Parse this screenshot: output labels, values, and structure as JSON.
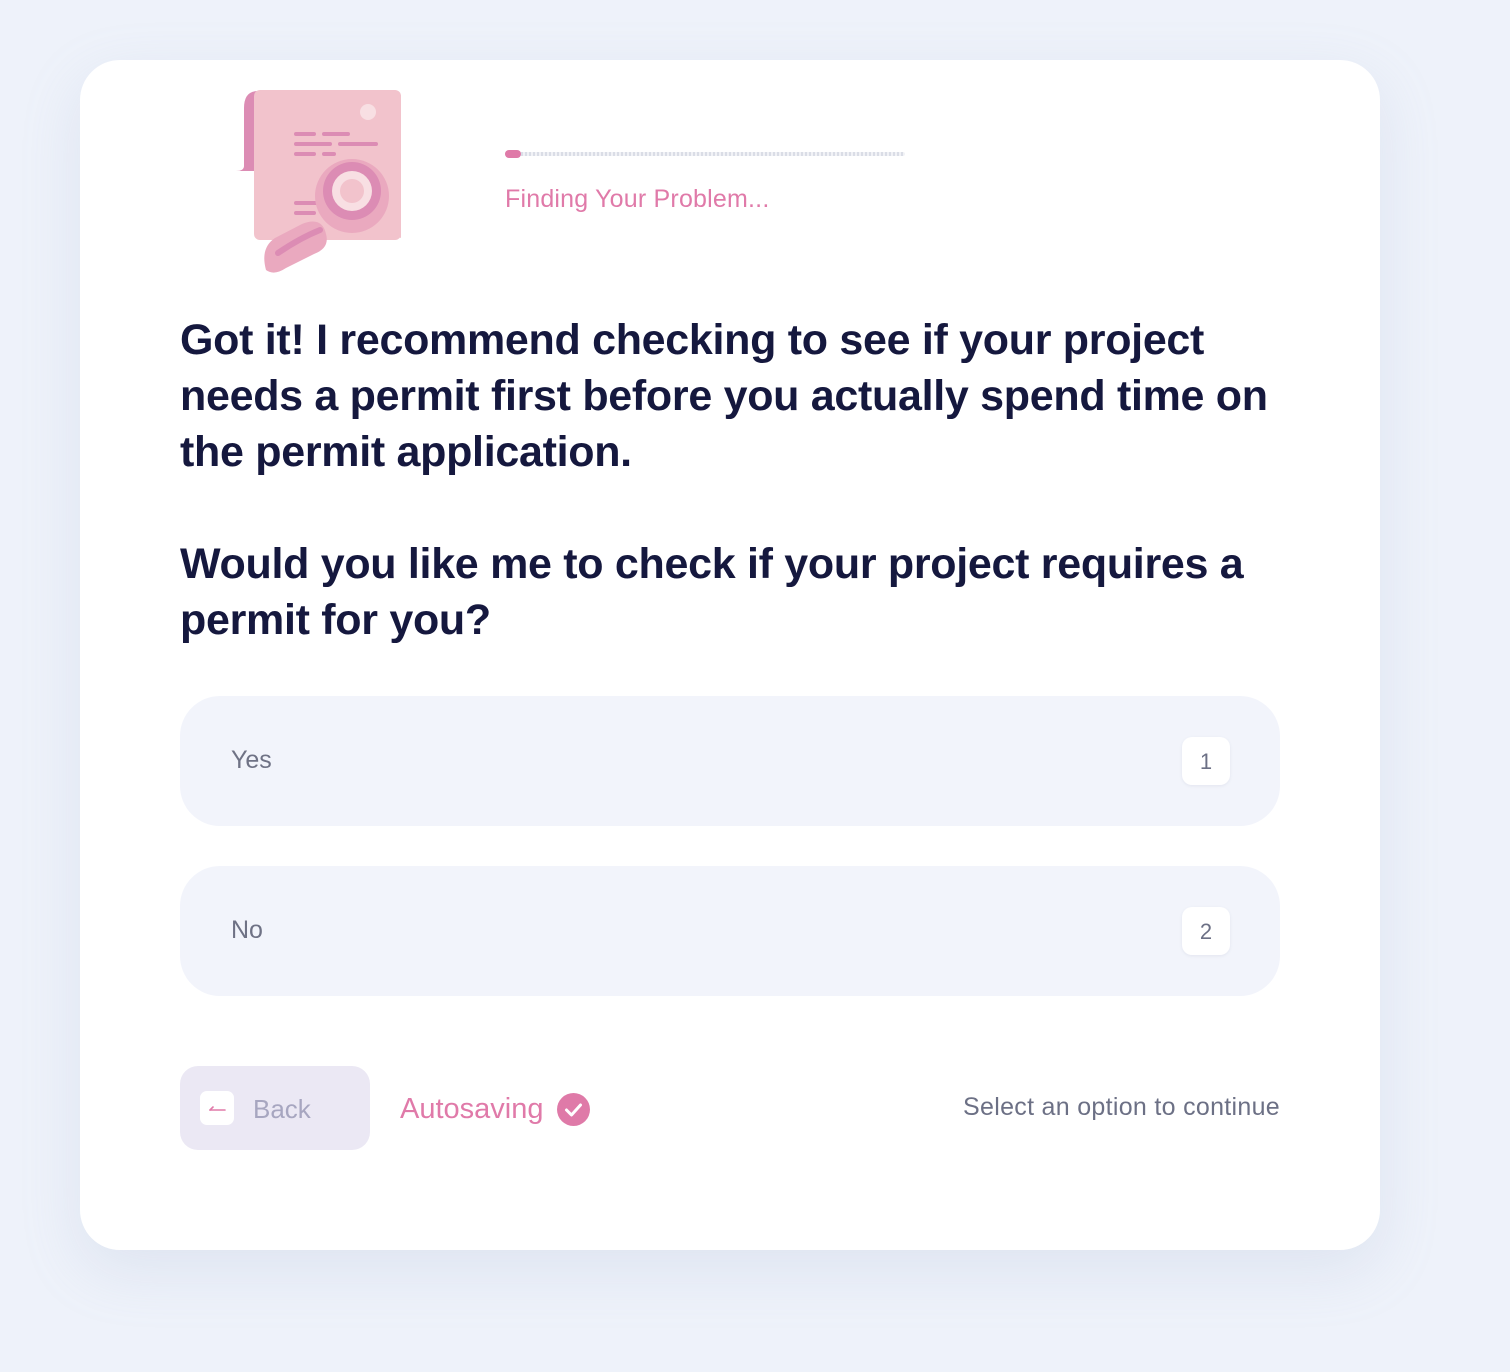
{
  "progress": {
    "label": "Finding Your Problem...",
    "value_fraction": 0.04
  },
  "question": {
    "intro": "Got it! I recommend checking to see if your project needs a permit first before you actually spend time on the permit application.",
    "prompt": "Would you like me to check if your project requires a permit for you?"
  },
  "options": [
    {
      "label": "Yes",
      "key": "1"
    },
    {
      "label": "No",
      "key": "2"
    }
  ],
  "footer": {
    "back_label": "Back",
    "autosave_label": "Autosaving",
    "hint": "Select an option to continue"
  },
  "colors": {
    "accent": "#df7aa8",
    "heading": "#15183e",
    "background": "#eef2fa"
  },
  "icons": {
    "illustration": "document-magnifier-icon",
    "back": "arrow-left-icon",
    "autosave": "check-circle-icon"
  }
}
